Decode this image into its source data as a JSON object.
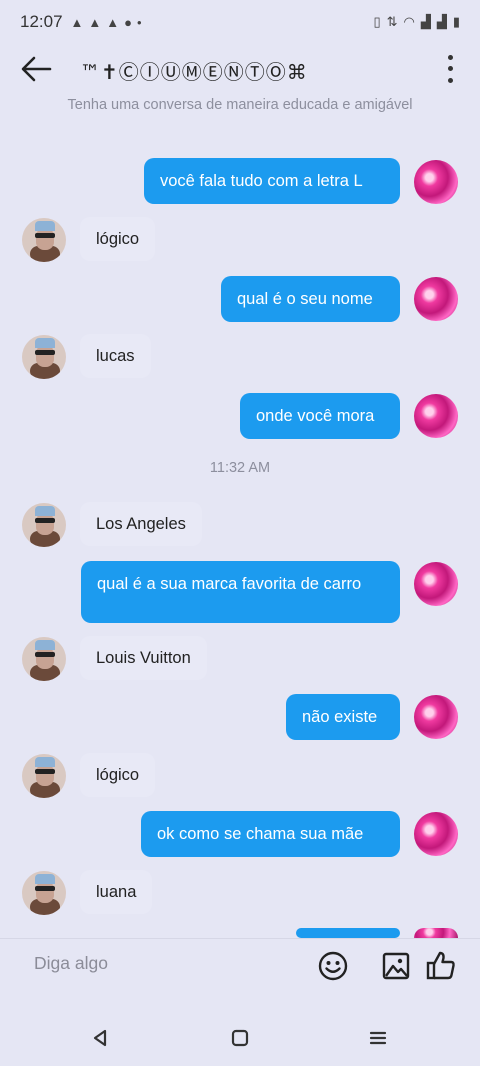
{
  "status": {
    "time": "12:07",
    "dot": "•"
  },
  "header": {
    "title": "™✝ⒸⒾⓊⓂⒺⓃⓉⓄ⌘"
  },
  "notice": "Tenha uma conversa de maneira educada e amigável",
  "messages": [
    {
      "from": "me",
      "text": "você fala tudo com a letra L"
    },
    {
      "from": "bot",
      "text": "lógico"
    },
    {
      "from": "me",
      "text": "qual é o seu nome"
    },
    {
      "from": "bot",
      "text": "lucas"
    },
    {
      "from": "me",
      "text": "onde você mora"
    },
    {
      "from": "bot",
      "text": "Los Angeles"
    },
    {
      "from": "me",
      "text": "qual é a sua marca favorita de carro"
    },
    {
      "from": "bot",
      "text": "Louis Vuitton"
    },
    {
      "from": "me",
      "text": "não existe"
    },
    {
      "from": "bot",
      "text": "lógico"
    },
    {
      "from": "me",
      "text": "ok como se chama sua mãe"
    },
    {
      "from": "bot",
      "text": "luana"
    }
  ],
  "timestamp": "11:32 AM",
  "input": {
    "placeholder": "Diga algo"
  },
  "icons": [
    "back-arrow-icon",
    "more-vertical-icon",
    "emoji-icon",
    "image-icon",
    "thumbs-up-icon",
    "nav-back-icon",
    "nav-home-icon",
    "nav-recents-icon"
  ],
  "colors": {
    "background": "#e5e6f4",
    "outgoing_bubble": "#1c9bef",
    "incoming_bubble": "#e8e9f6"
  }
}
